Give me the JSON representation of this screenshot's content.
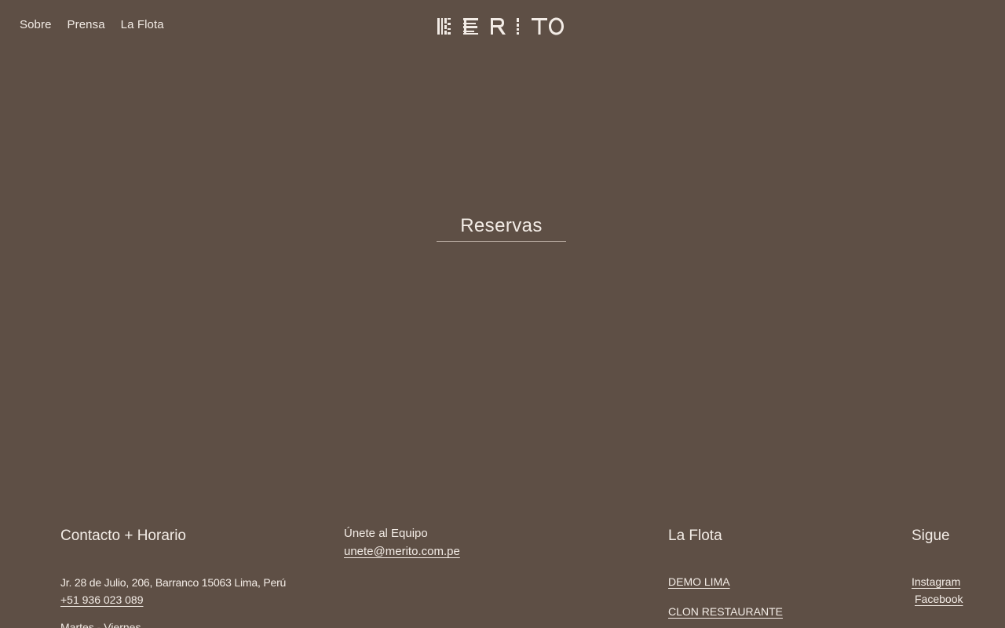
{
  "nav": {
    "items": [
      {
        "label": "Sobre"
      },
      {
        "label": "Prensa"
      },
      {
        "label": "La Flota"
      }
    ]
  },
  "logo": {
    "text": "MERITO",
    "icon": "merito-logo"
  },
  "reservation": {
    "label": "Reservas"
  },
  "footer": {
    "contact": {
      "heading": "Contacto + Horario",
      "address": "Jr. 28 de Julio, 206, Barranco 15063 Lima, Perú",
      "phone": "+51 936 023 089",
      "hours": "Martes - Viernes"
    },
    "join": {
      "label": "Únete al Equipo",
      "email": "unete@merito.com.pe"
    },
    "fleet": {
      "heading": "La Flota",
      "items": [
        {
          "label": "DEMO LIMA"
        },
        {
          "label": "CLON RESTAURANTE"
        }
      ]
    },
    "follow": {
      "heading": "Sigue",
      "items": [
        {
          "label": "Instagram"
        },
        {
          "label": "Facebook"
        }
      ]
    }
  },
  "colors": {
    "background": "#5e4f45",
    "text": "#f3ece6",
    "underline": "#b8aaa0"
  }
}
